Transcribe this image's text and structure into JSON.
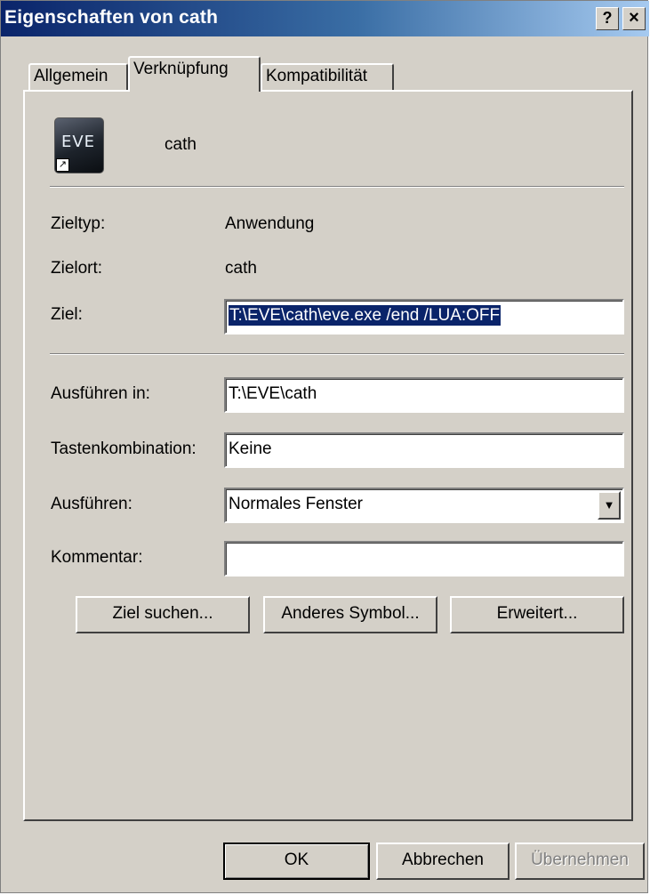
{
  "window": {
    "title": "Eigenschaften von cath",
    "help_glyph": "?",
    "close_glyph": "×"
  },
  "tabs": [
    {
      "label": "Allgemein",
      "selected": false
    },
    {
      "label": "Verknüpfung",
      "selected": true
    },
    {
      "label": "Kompatibilität",
      "selected": false
    }
  ],
  "shortcut": {
    "name": "cath",
    "icon": "eve-app-icon",
    "target_type_label": "Zieltyp:",
    "target_type_value": "Anwendung",
    "target_location_label": "Zielort:",
    "target_location_value": "cath",
    "target_label": "Ziel:",
    "target_value": "T:\\EVE\\cath\\eve.exe /end /LUA:OFF",
    "start_in_label": "Ausführen in:",
    "start_in_value": "T:\\EVE\\cath",
    "hotkey_label": "Tastenkombination:",
    "hotkey_value": "Keine",
    "run_label": "Ausführen:",
    "run_value": "Normales Fenster",
    "comment_label": "Kommentar:",
    "comment_value": ""
  },
  "actions": {
    "find_target": "Ziel suchen...",
    "change_icon": "Anderes Symbol...",
    "advanced": "Erweitert..."
  },
  "footer": {
    "ok": "OK",
    "cancel": "Abbrechen",
    "apply": "Übernehmen"
  }
}
